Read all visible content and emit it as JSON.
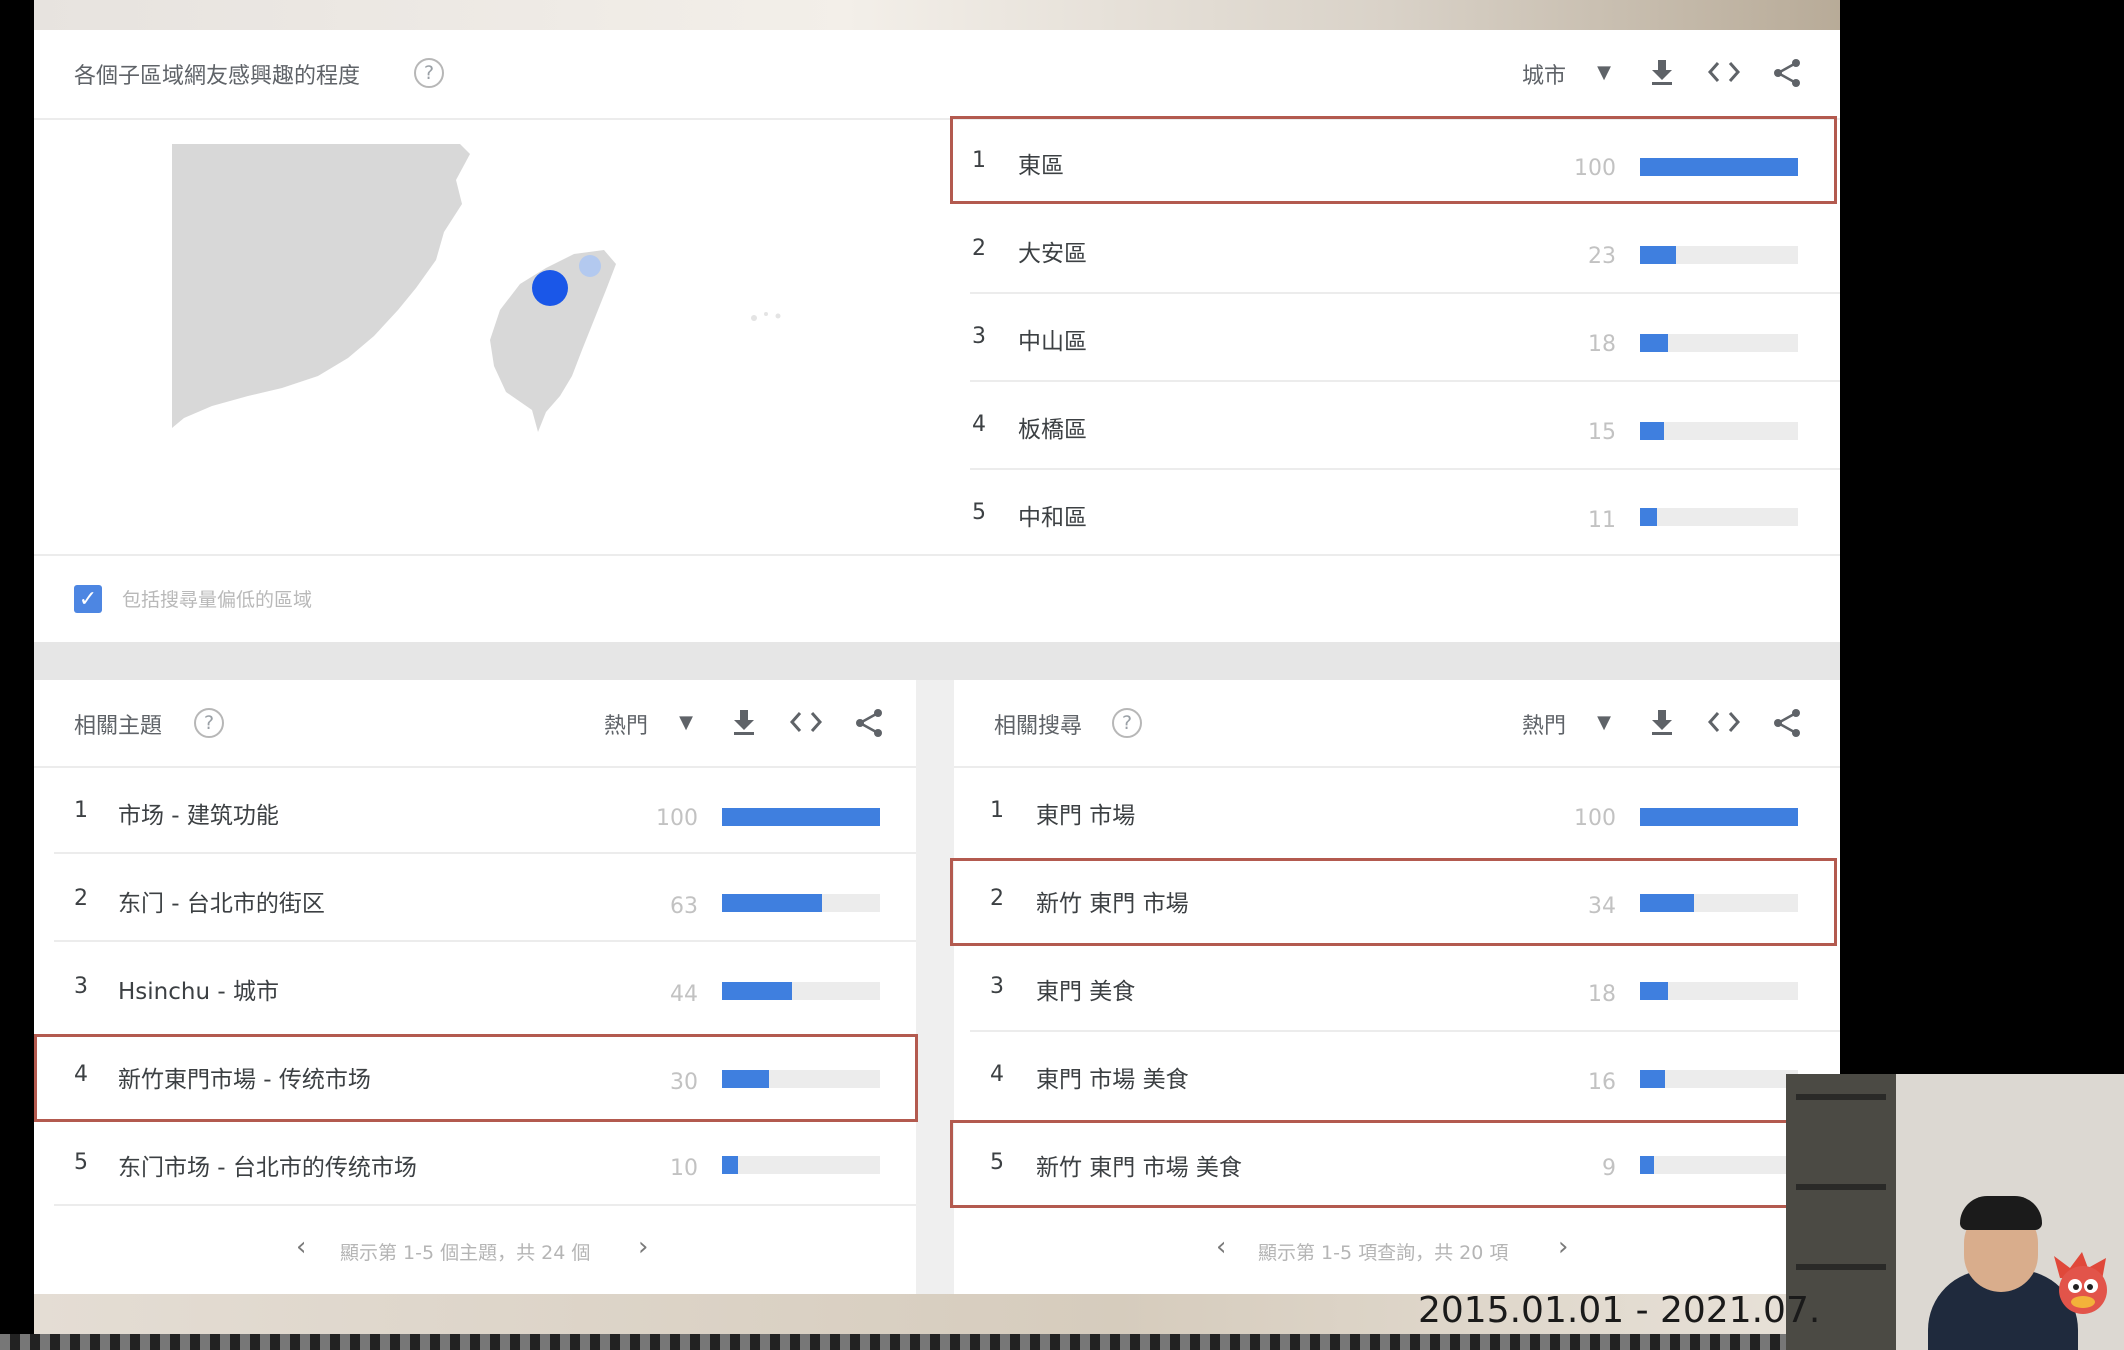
{
  "region_panel": {
    "title": "各個子區域網友感興趣的程度",
    "help": "?",
    "resolution_select": "城市",
    "icons": [
      "download-icon",
      "embed-icon",
      "share-icon"
    ],
    "rows": [
      {
        "rank": "1",
        "name": "東區",
        "value": "100",
        "score": 100,
        "highlighted": true
      },
      {
        "rank": "2",
        "name": "大安區",
        "value": "23",
        "score": 23,
        "highlighted": false
      },
      {
        "rank": "3",
        "name": "中山區",
        "value": "18",
        "score": 18,
        "highlighted": false
      },
      {
        "rank": "4",
        "name": "板橋區",
        "value": "15",
        "score": 15,
        "highlighted": false
      },
      {
        "rank": "5",
        "name": "中和區",
        "value": "11",
        "score": 11,
        "highlighted": false
      }
    ],
    "include_low_volume_label": "包括搜尋量偏低的區域",
    "include_low_volume_checked": true
  },
  "related_topics": {
    "title": "相關主題",
    "help": "?",
    "filter_select": "熱門",
    "rows": [
      {
        "rank": "1",
        "name": "市场 - 建筑功能",
        "value": "100",
        "score": 100,
        "highlighted": false
      },
      {
        "rank": "2",
        "name": "东门 - 台北市的街区",
        "value": "63",
        "score": 63,
        "highlighted": false
      },
      {
        "rank": "3",
        "name": "Hsinchu - 城市",
        "value": "44",
        "score": 44,
        "highlighted": false
      },
      {
        "rank": "4",
        "name": "新竹東門市場 - 传统市场",
        "value": "30",
        "score": 30,
        "highlighted": true
      },
      {
        "rank": "5",
        "name": "东门市场 - 台北市的传统市场",
        "value": "10",
        "score": 10,
        "highlighted": false
      }
    ],
    "pager": "顯示第 1-5 個主題，共 24 個"
  },
  "related_queries": {
    "title": "相關搜尋",
    "help": "?",
    "filter_select": "熱門",
    "rows": [
      {
        "rank": "1",
        "name": "東門 市場",
        "value": "100",
        "score": 100,
        "highlighted": false
      },
      {
        "rank": "2",
        "name": "新竹 東門 市場",
        "value": "34",
        "score": 34,
        "highlighted": true
      },
      {
        "rank": "3",
        "name": "東門 美食",
        "value": "18",
        "score": 18,
        "highlighted": false
      },
      {
        "rank": "4",
        "name": "東門 市場 美食",
        "value": "16",
        "score": 16,
        "highlighted": false
      },
      {
        "rank": "5",
        "name": "新竹 東門 市場 美食",
        "value": "9",
        "score": 9,
        "highlighted": true
      }
    ],
    "pager": "顯示第 1-5 項查詢，共 20 項"
  },
  "overlay": {
    "date_range": "2015.01.01 - 2021.07."
  },
  "colors": {
    "bar_fill": "#3f7fdf",
    "bar_track": "#ececec",
    "highlight_border": "#b35a4f",
    "map_dot": "#1a57e8"
  }
}
